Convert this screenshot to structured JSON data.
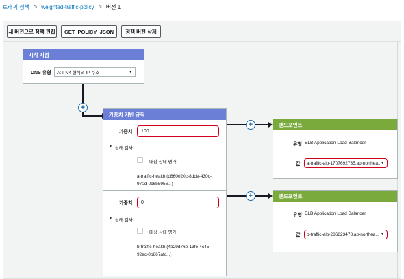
{
  "breadcrumb": {
    "item1": "트래픽 정책",
    "item2": "weighted-traffic-policy",
    "current": "버전 1",
    "separator": ">"
  },
  "toolbar": {
    "edit_label": "새 버전으로 정책 편집",
    "json_label": "GET_POLICY_JSON",
    "delete_label": "정책 버전 삭제"
  },
  "start_node": {
    "title": "시작 지점",
    "dns_type_label": "DNS 유형",
    "dns_type_value": "A: IPv4 형식의 IP 주소"
  },
  "weighted_rule": {
    "title": "가중치 기반 규칙",
    "entries": [
      {
        "weight_label": "가중치",
        "weight_value": "100",
        "health_section": "상태 검사",
        "evaluate_label": "대상 상태 평가",
        "health_check_line1": "a-traffic-health (d860020c-8dde-430c-",
        "health_check_line2": "970d-0c6b5956...)"
      },
      {
        "weight_label": "가중치",
        "weight_value": "0",
        "health_section": "상태 검사",
        "evaluate_label": "대상 상태 평가",
        "health_check_line1": "b-traffic-health (4a29d76e-13fe-4c45-",
        "health_check_line2": "92ec-0b867afc...)"
      }
    ]
  },
  "endpoints": [
    {
      "title": "엔드포인트",
      "type_label": "유형",
      "type_value": "ELB Application Load Balancer",
      "value_label": "값",
      "value": "a-traffic-alb-1707692735.ap-northea..."
    },
    {
      "title": "엔드포인트",
      "type_label": "유형",
      "type_value": "ELB Application Load Balancer",
      "value_label": "값",
      "value": "b-traffic-alb-286823478.ap-northea..."
    }
  ],
  "icons": {
    "plus": "+",
    "caret_down": "▼",
    "collapse_triangle": "▼"
  },
  "colors": {
    "rule_header": "#6b7fd6",
    "endpoint_header": "#7aa93c",
    "highlight_border": "#d0021b",
    "link": "#0073bb"
  }
}
